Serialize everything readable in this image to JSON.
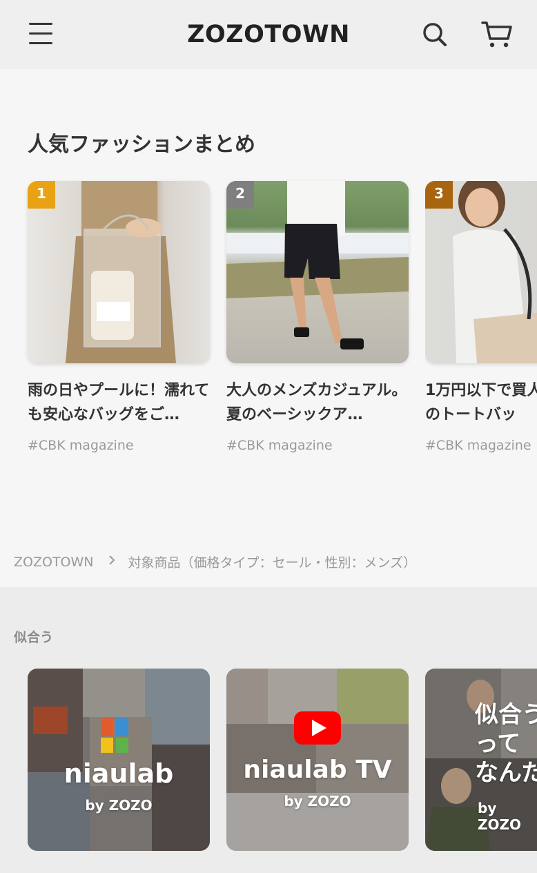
{
  "header": {
    "logo": "ZOZOTOWN"
  },
  "section": {
    "title": "人気ファッションまとめ"
  },
  "cards": [
    {
      "rank": "1",
      "rank_color": "#e8a214",
      "title": "雨の日やプールに！濡れても安心なバッグをご…",
      "tag": "#CBK magazine"
    },
    {
      "rank": "2",
      "rank_color": "#7f7f7f",
      "title": "大人のメンズカジュアル。夏のベーシックア…",
      "tag": "#CBK magazine"
    },
    {
      "rank": "3",
      "rank_color": "#a8640f",
      "title": "1万円以下で買人のトートバッ",
      "tag": "#CBK magazine"
    }
  ],
  "breadcrumb": {
    "home": "ZOZOTOWN",
    "current": "対象商品（価格タイプ：セール・性別：メンズ）"
  },
  "lower": {
    "title": "似合う",
    "promos": [
      {
        "name": "niaulab",
        "by": "by ZOZO"
      },
      {
        "name": "niaulab TV",
        "by": "by ZOZO"
      },
      {
        "name": "似合う\nって\nなんだ",
        "by": "by ZOZO"
      }
    ]
  }
}
